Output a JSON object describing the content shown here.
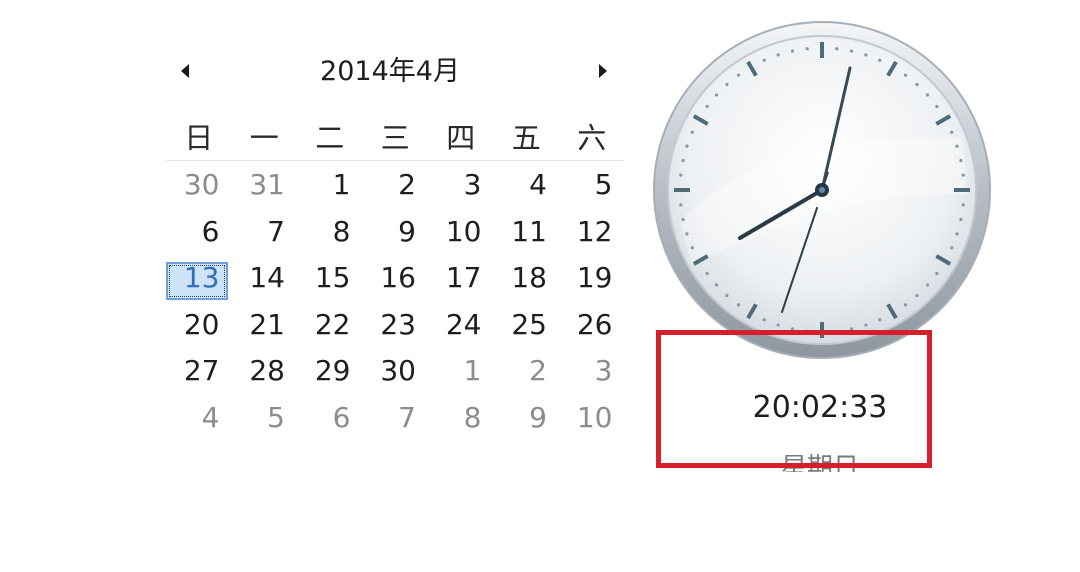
{
  "calendar": {
    "title": "2014年4月",
    "prev_icon": "triangle-left-icon",
    "next_icon": "triangle-right-icon",
    "weekdays": [
      "日",
      "一",
      "二",
      "三",
      "四",
      "五",
      "六"
    ],
    "days": [
      {
        "label": "30",
        "type": "other"
      },
      {
        "label": "31",
        "type": "other"
      },
      {
        "label": "1",
        "type": "current"
      },
      {
        "label": "2",
        "type": "current"
      },
      {
        "label": "3",
        "type": "current"
      },
      {
        "label": "4",
        "type": "current"
      },
      {
        "label": "5",
        "type": "current"
      },
      {
        "label": "6",
        "type": "current"
      },
      {
        "label": "7",
        "type": "current"
      },
      {
        "label": "8",
        "type": "current"
      },
      {
        "label": "9",
        "type": "current"
      },
      {
        "label": "10",
        "type": "current"
      },
      {
        "label": "11",
        "type": "current"
      },
      {
        "label": "12",
        "type": "current"
      },
      {
        "label": "13",
        "type": "today"
      },
      {
        "label": "14",
        "type": "current"
      },
      {
        "label": "15",
        "type": "current"
      },
      {
        "label": "16",
        "type": "current"
      },
      {
        "label": "17",
        "type": "current"
      },
      {
        "label": "18",
        "type": "current"
      },
      {
        "label": "19",
        "type": "current"
      },
      {
        "label": "20",
        "type": "current"
      },
      {
        "label": "21",
        "type": "current"
      },
      {
        "label": "22",
        "type": "current"
      },
      {
        "label": "23",
        "type": "current"
      },
      {
        "label": "24",
        "type": "current"
      },
      {
        "label": "25",
        "type": "current"
      },
      {
        "label": "26",
        "type": "current"
      },
      {
        "label": "27",
        "type": "current"
      },
      {
        "label": "28",
        "type": "current"
      },
      {
        "label": "29",
        "type": "current"
      },
      {
        "label": "30",
        "type": "current"
      },
      {
        "label": "1",
        "type": "other"
      },
      {
        "label": "2",
        "type": "other"
      },
      {
        "label": "3",
        "type": "other"
      },
      {
        "label": "4",
        "type": "other"
      },
      {
        "label": "5",
        "type": "other"
      },
      {
        "label": "6",
        "type": "other"
      },
      {
        "label": "7",
        "type": "other"
      },
      {
        "label": "8",
        "type": "other"
      },
      {
        "label": "9",
        "type": "other"
      },
      {
        "label": "10",
        "type": "other"
      }
    ]
  },
  "clock": {
    "icon": "analog-clock-icon",
    "time": "20:02:33",
    "date_label": "星期日"
  },
  "colors": {
    "today_fill": "#cfe3f8",
    "today_text": "#2f6fb8",
    "highlight": "#d4202a",
    "other_month": "#8c8c8c"
  }
}
